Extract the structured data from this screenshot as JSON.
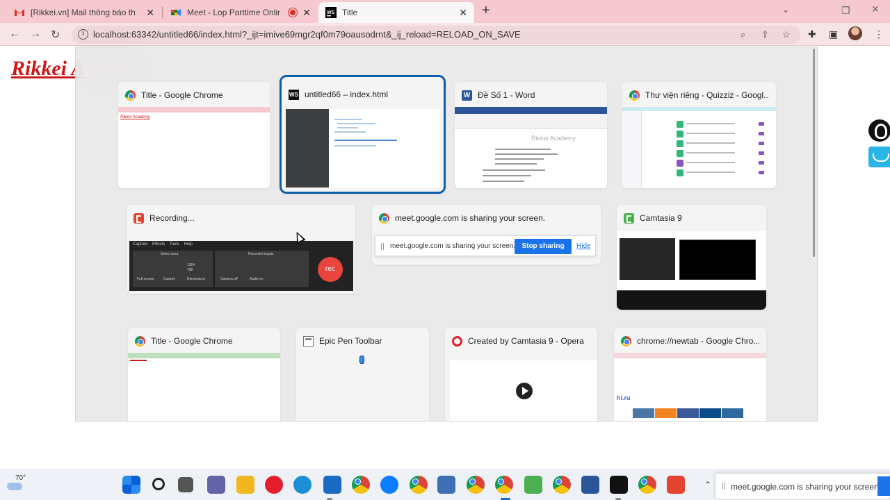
{
  "browser": {
    "tabs": [
      {
        "title": "[Rikkei.vn] Mail thông báo thiếu",
        "icon": "gmail-icon",
        "active": false
      },
      {
        "title": "Meet - Lop Parttime Online T",
        "icon": "meet-icon",
        "active": false,
        "recording": true
      },
      {
        "title": "Title",
        "icon": "webstorm-icon",
        "active": true
      }
    ],
    "url": "localhost:63342/untitled66/index.html?_ijt=imive69mgr2qf0m79oausodrnt&_ij_reload=RELOAD_ON_SAVE"
  },
  "page": {
    "logo_text": "Rikkei A"
  },
  "task_view": {
    "windows": [
      {
        "title": "Title - Google Chrome",
        "icon": "chrome-icon",
        "thumb_text": "Rikkei Academy"
      },
      {
        "title": "untitled66 – index.html",
        "icon": "webstorm-icon",
        "selected": true
      },
      {
        "title": "Đề Số 1 - Word",
        "icon": "word-icon",
        "thumb_brand": "Rikkei Academy"
      },
      {
        "title": "Thư viện riêng - Quizziz - Googl...",
        "icon": "chrome-icon"
      },
      {
        "title": "Recording...",
        "icon": "camtasia-recorder-icon"
      },
      {
        "title": "meet.google.com is sharing your screen.",
        "icon": "chrome-icon"
      },
      {
        "title": "Camtasia 9",
        "icon": "camtasia-icon"
      },
      {
        "title": "Title - Google Chrome",
        "icon": "chrome-icon"
      },
      {
        "title": "Epic Pen Toolbar",
        "icon": "epic-pen-icon"
      },
      {
        "title": "Created by Camtasia 9 - Opera",
        "icon": "opera-icon"
      },
      {
        "title": "chrome://newtab - Google Chro...",
        "icon": "chrome-icon",
        "thumb_brand": "hi.ru"
      }
    ],
    "recorder": {
      "menu": "Capture Effects Tools Help",
      "select_area": "Select area",
      "recorded_inputs": "Recorded inputs",
      "full_screen": "Full screen",
      "custom": "Custom",
      "dimensions": "Dimensions",
      "width": "1364",
      "height": "768",
      "camera": "Camera off",
      "audio": "Audio on",
      "rec_label": "rec"
    },
    "share_bar": {
      "message": "meet.google.com is sharing your screen.",
      "stop_label": "Stop sharing",
      "hide_label": "Hide"
    }
  },
  "taskbar": {
    "temperature": "70°",
    "tray_share_message": "meet.google.com is sharing your screen."
  }
}
